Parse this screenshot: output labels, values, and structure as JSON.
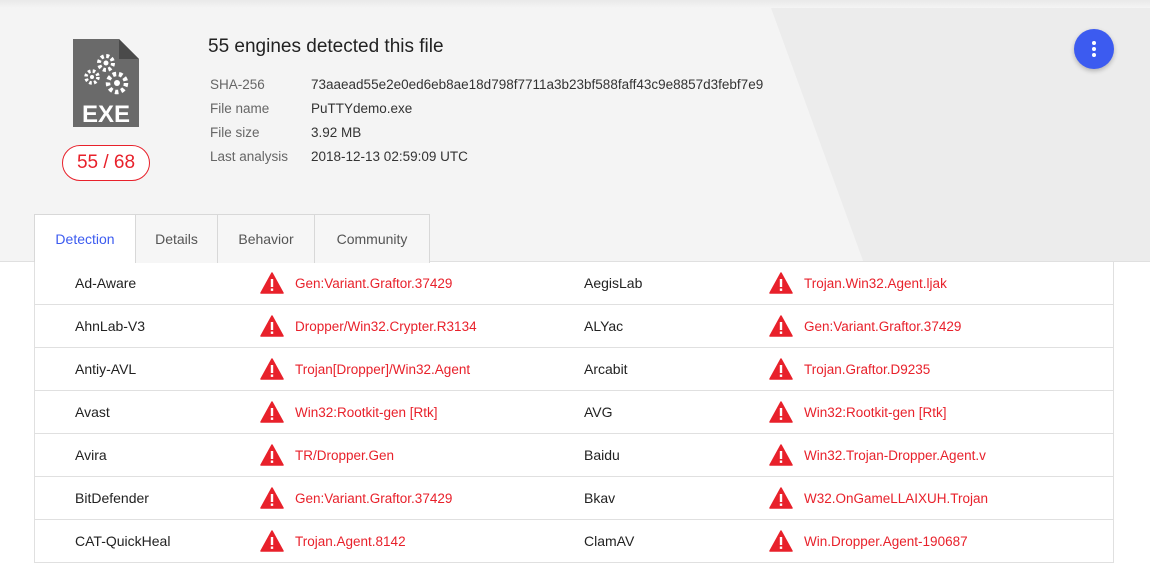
{
  "file": {
    "title": "55 engines detected this file",
    "icon": "exe-file-icon",
    "score": "55 / 68",
    "meta": [
      {
        "key": "SHA-256",
        "value": "73aaead55e2e0ed6eb8ae18d798f7711a3b23bf588faff43c9e8857d3febf7e9"
      },
      {
        "key": "File name",
        "value": "PuTTYdemo.exe"
      },
      {
        "key": "File size",
        "value": "3.92 MB"
      },
      {
        "key": "Last analysis",
        "value": "2018-12-13 02:59:09 UTC"
      }
    ]
  },
  "menu": {
    "icon": "more-vertical-icon"
  },
  "tabs": [
    {
      "label": "Detection",
      "active": true
    },
    {
      "label": "Details",
      "active": false
    },
    {
      "label": "Behavior",
      "active": false
    },
    {
      "label": "Community",
      "active": false
    }
  ],
  "detections": [
    {
      "left": {
        "engine": "Ad-Aware",
        "result": "Gen:Variant.Graftor.37429"
      },
      "right": {
        "engine": "AegisLab",
        "result": "Trojan.Win32.Agent.ljak"
      }
    },
    {
      "left": {
        "engine": "AhnLab-V3",
        "result": "Dropper/Win32.Crypter.R3134"
      },
      "right": {
        "engine": "ALYac",
        "result": "Gen:Variant.Graftor.37429"
      }
    },
    {
      "left": {
        "engine": "Antiy-AVL",
        "result": "Trojan[Dropper]/Win32.Agent"
      },
      "right": {
        "engine": "Arcabit",
        "result": "Trojan.Graftor.D9235"
      }
    },
    {
      "left": {
        "engine": "Avast",
        "result": "Win32:Rootkit-gen [Rtk]"
      },
      "right": {
        "engine": "AVG",
        "result": "Win32:Rootkit-gen [Rtk]"
      }
    },
    {
      "left": {
        "engine": "Avira",
        "result": "TR/Dropper.Gen"
      },
      "right": {
        "engine": "Baidu",
        "result": "Win32.Trojan-Dropper.Agent.v"
      }
    },
    {
      "left": {
        "engine": "BitDefender",
        "result": "Gen:Variant.Graftor.37429"
      },
      "right": {
        "engine": "Bkav",
        "result": "W32.OnGameLLAIXUH.Trojan"
      }
    },
    {
      "left": {
        "engine": "CAT-QuickHeal",
        "result": "Trojan.Agent.8142"
      },
      "right": {
        "engine": "ClamAV",
        "result": "Win.Dropper.Agent-190687"
      }
    }
  ],
  "colors": {
    "accent": "#3c5bf0",
    "danger": "#e8212b"
  }
}
